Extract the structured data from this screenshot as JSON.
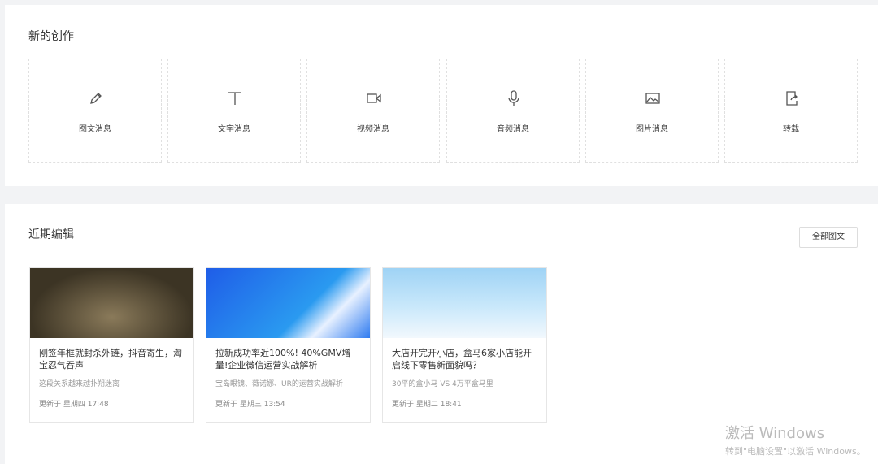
{
  "create": {
    "title": "新的创作",
    "items": [
      {
        "label": "图文消息",
        "icon": "pencil-icon"
      },
      {
        "label": "文字消息",
        "icon": "text-icon"
      },
      {
        "label": "视频消息",
        "icon": "video-icon"
      },
      {
        "label": "音频消息",
        "icon": "microphone-icon"
      },
      {
        "label": "图片消息",
        "icon": "image-icon"
      },
      {
        "label": "转载",
        "icon": "share-icon"
      }
    ]
  },
  "recent": {
    "title": "近期编辑",
    "all_button": "全部图文",
    "articles": [
      {
        "title": "刚签年框就封杀外链，抖音寄生，淘宝忍气吞声",
        "summary": "这段关系越来越扑朔迷离",
        "updated": "更新于 星期四 17:48"
      },
      {
        "title": "拉新成功率近100%! 40%GMV增量!企业微信运营实战解析",
        "summary": "宝岛眼镜、薇诺娜、UR的运营实战解析",
        "updated": "更新于 星期三 13:54"
      },
      {
        "title": "大店开完开小店，盒马6家小店能开启线下零售新面貌吗？",
        "summary": "30平的盒小马 VS 4万平盒马里",
        "updated": "更新于 星期二 18:41"
      }
    ]
  },
  "watermark": {
    "line1": "激活 Windows",
    "line2": "转到\"电脑设置\"以激活 Windows。"
  }
}
